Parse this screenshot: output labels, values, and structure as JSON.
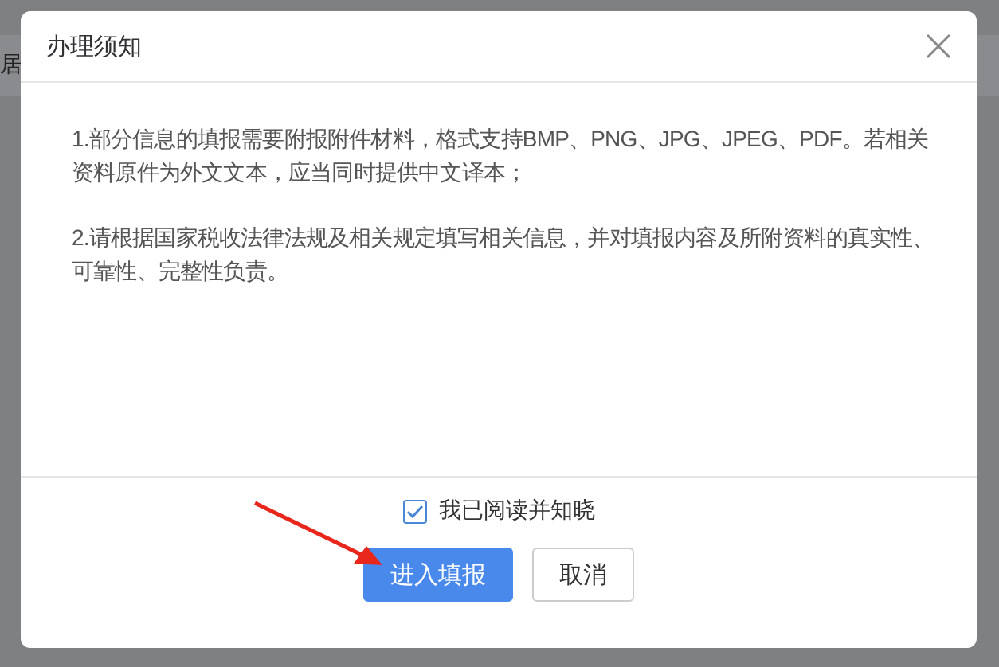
{
  "background_page": {
    "text": "居"
  },
  "dialog": {
    "title": "办理须知",
    "paragraphs": [
      "1.部分信息的填报需要附报附件材料，格式支持BMP、PNG、JPG、JPEG、PDF。若相关资料原件为外文文本，应当同时提供中文译本；",
      "2.请根据国家税收法律法规及相关规定填写相关信息，并对填报内容及所附资料的真实性、可靠性、完整性负责。"
    ],
    "agreement": {
      "label": "我已阅读并知晓",
      "checked": true
    },
    "buttons": [
      {
        "label": "进入填报",
        "kind": "primary"
      },
      {
        "label": "取消",
        "kind": "default"
      }
    ]
  }
}
